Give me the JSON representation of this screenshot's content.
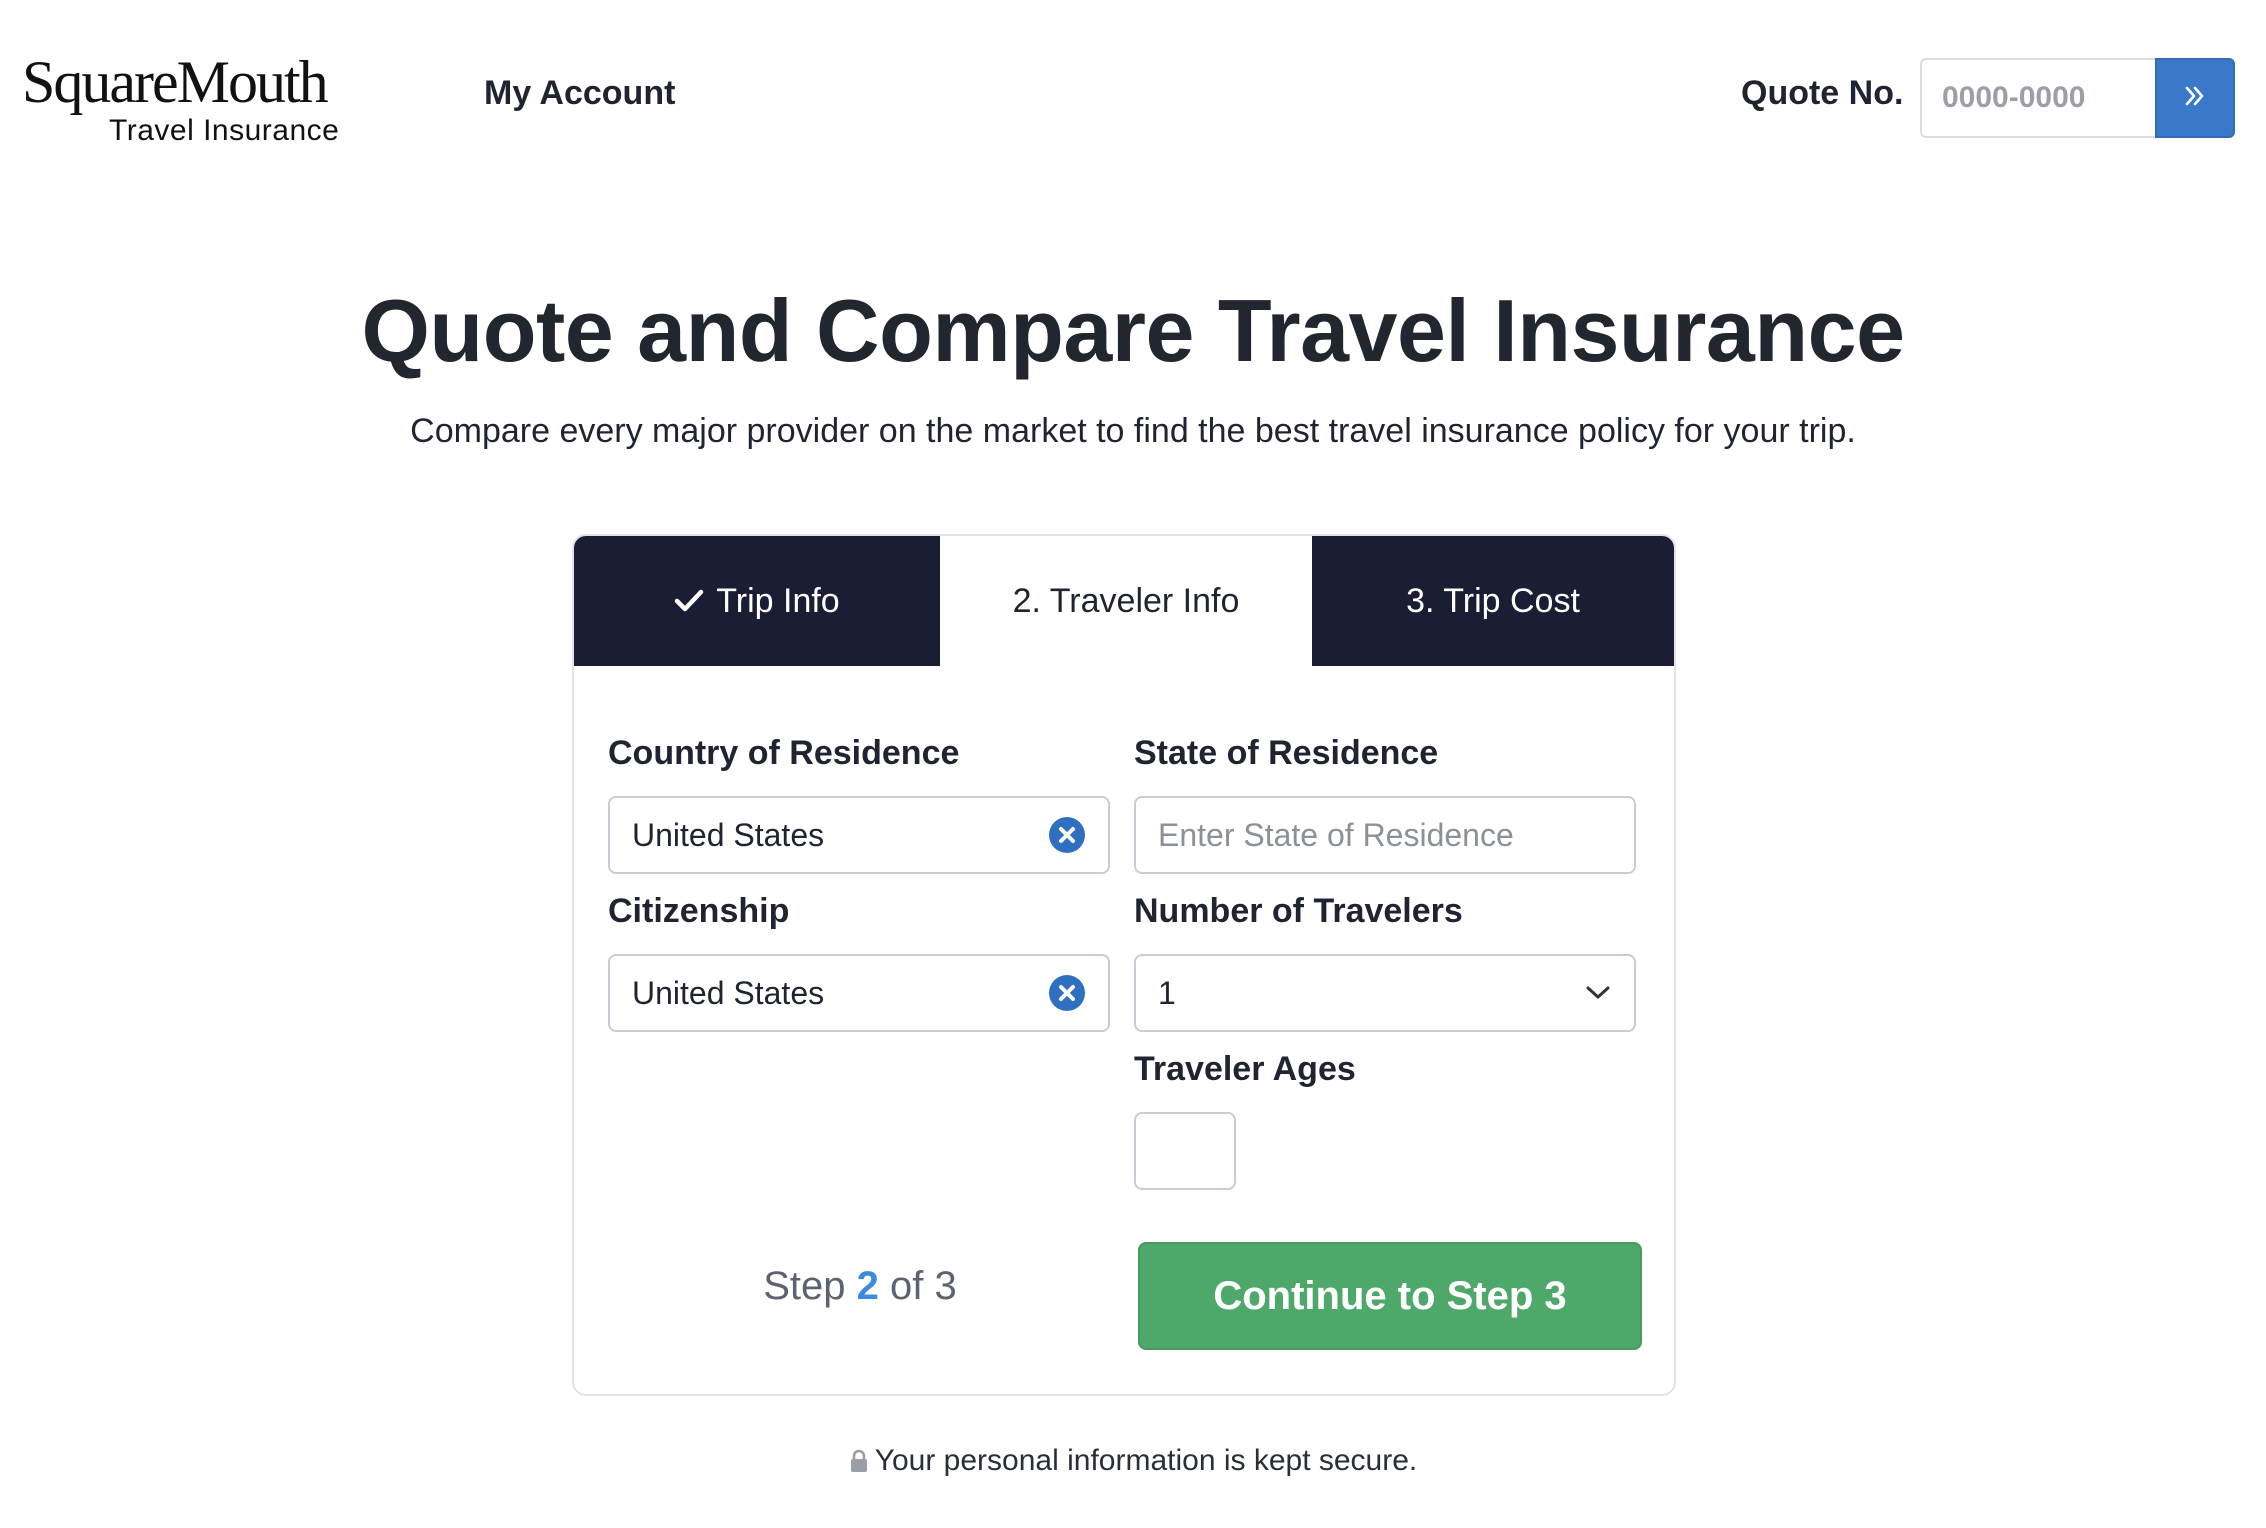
{
  "header": {
    "logo_main": "SquareMouth",
    "logo_sub": "Travel Insurance",
    "my_account": "My Account",
    "quote_label": "Quote No.",
    "quote_placeholder": "0000-0000"
  },
  "hero": {
    "title": "Quote and Compare Travel Insurance",
    "subtitle": "Compare every major provider on the market to find the best travel insurance policy for your trip."
  },
  "tabs": [
    {
      "label": "Trip Info",
      "state": "done"
    },
    {
      "label": "2. Traveler Info",
      "state": "active"
    },
    {
      "label": "3. Trip Cost",
      "state": "next"
    }
  ],
  "form": {
    "country_label": "Country of Residence",
    "country_value": "United States",
    "state_label": "State of Residence",
    "state_placeholder": "Enter State of Residence",
    "citizenship_label": "Citizenship",
    "citizenship_value": "United States",
    "travelers_label": "Number of Travelers",
    "travelers_value": "1",
    "ages_label": "Traveler Ages",
    "ages_value": ""
  },
  "progress": {
    "prefix": "Step",
    "current": "2",
    "suffix": "of 3",
    "continue_label": "Continue to Step 3"
  },
  "footer": {
    "secure_text": "Your personal information is kept secure."
  },
  "colors": {
    "tab_dark": "#1a1d33",
    "accent_blue": "#3a78c9",
    "continue_green": "#4ea86a",
    "step_blue": "#3b8be0"
  },
  "icons": {
    "tab_done": "check-icon",
    "quote_go": "double-chevron-right-icon",
    "clear": "clear-circle-x-icon",
    "dropdown": "chevron-down-icon",
    "secure": "lock-icon"
  }
}
